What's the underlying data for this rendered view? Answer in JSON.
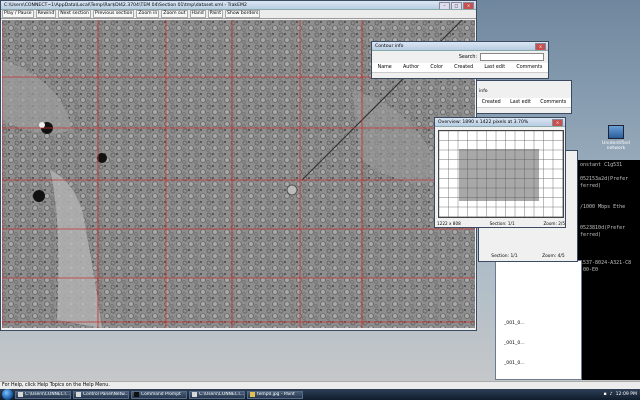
{
  "viewer": {
    "title": "C:\\Users\\CONNECT~1\\AppData\\Local\\Temp\\Rar$DI42.3704\\TEM 04\\Section 01\\tmp\\dataset.xml - TrakEM2",
    "toolbar": [
      "Play / Pause",
      "Rewind",
      "Next section",
      "Previous section",
      "Zoom in",
      "Zoom out",
      "Hand",
      "Paint",
      "Show borders"
    ]
  },
  "contour_info": {
    "title": "Contour info",
    "search_label": "Search:",
    "columns": [
      "Name",
      "Author",
      "Color",
      "Created",
      "Last edit",
      "Comments"
    ]
  },
  "contour_info_back": {
    "label": "info",
    "columns": [
      "Created",
      "Last edit",
      "Comments"
    ]
  },
  "overview": {
    "title": "Overview: 1890 x 1422 pixels at 3.70%",
    "footer": [
      "1222 x 808",
      "Section: 1/1",
      "Zoom: 2/5"
    ]
  },
  "back_window": {
    "footer": [
      "Section: 1/1",
      "Zoom: 4/5"
    ]
  },
  "desktop_icon": {
    "label": "Unidentified network"
  },
  "cmd": {
    "lines": [
      "onstant C1g531",
      "",
      "052153a2d(Prefer",
      "ferred)",
      "",
      "",
      "/1000 Mbps Ethe",
      "",
      "",
      "0523810d(Prefer",
      "ferred)",
      "",
      "",
      "",
      "1537-8024-A321-C8",
      "-00-E0"
    ]
  },
  "files": [
    "_001_0...",
    "_001_0...",
    "_001_0..."
  ],
  "status": {
    "text": "For Help, click Help Topics on the Help Menu."
  },
  "taskbar": {
    "buttons": [
      "C:\\Users\\CONNECT...",
      "Control Panel\\Netw...",
      "Command Prompt",
      "C:\\Users\\CONNECT...",
      "temp0.jpg - Paint"
    ],
    "clock": "12:09 PM"
  },
  "colors": {
    "grid_line": "#c83030",
    "overview_region": "#a8a8a8"
  }
}
